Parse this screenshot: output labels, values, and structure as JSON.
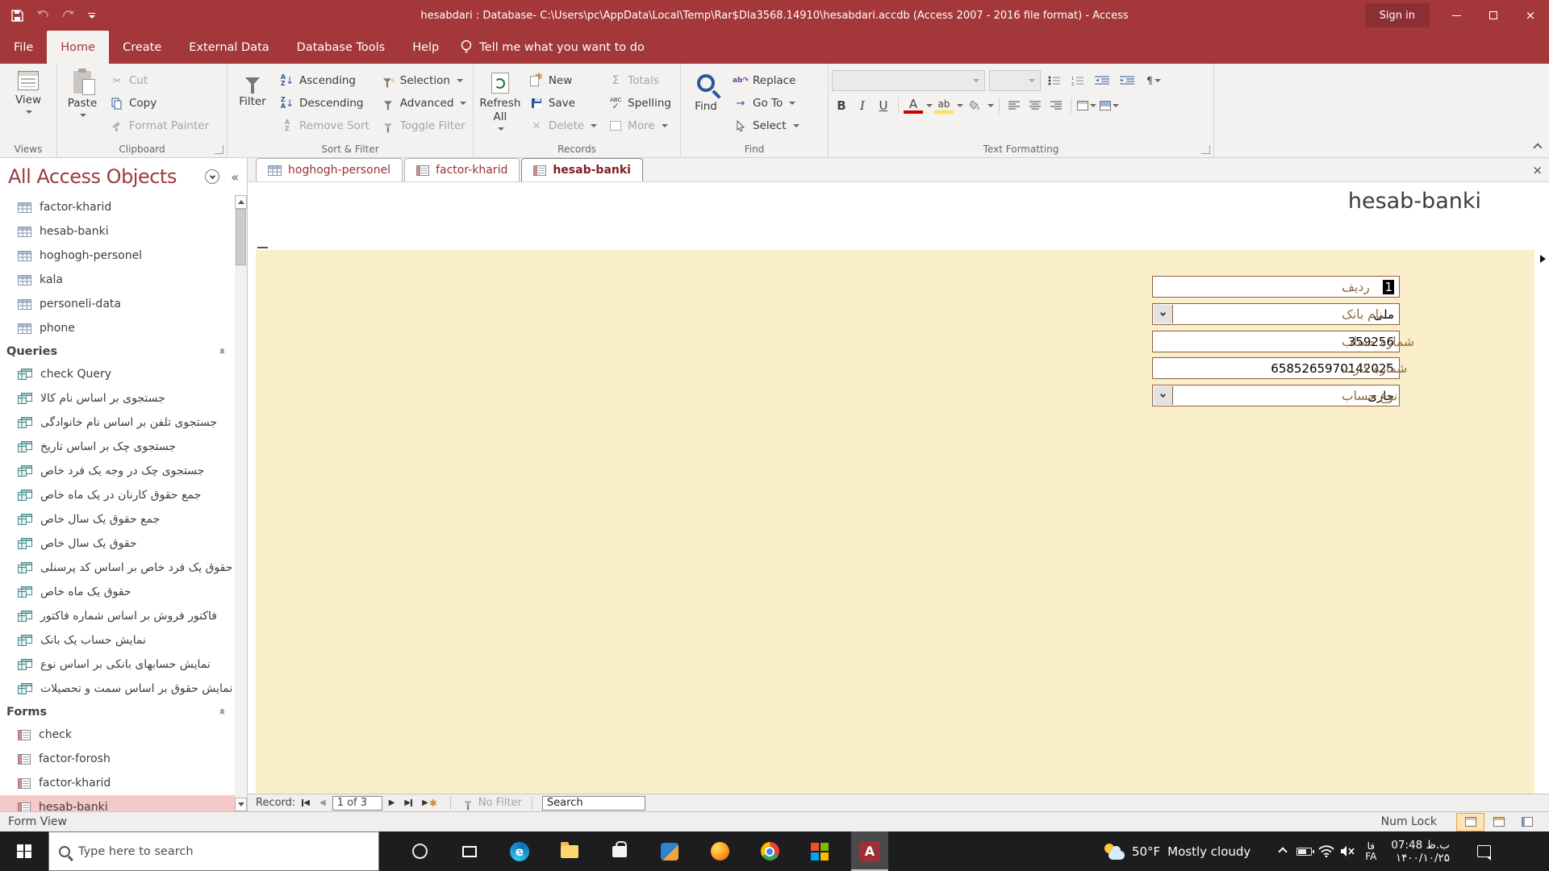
{
  "colors": {
    "accent": "#a4373a",
    "form_bg": "#fbeecb",
    "selection_pink": "#f5c8c9"
  },
  "titlebar": {
    "title": "hesabdari : Database- C:\\Users\\pc\\AppData\\Local\\Temp\\Rar$Dla3568.14910\\hesabdari.accdb (Access 2007 - 2016 file format) - Access",
    "sign_in": "Sign in"
  },
  "menu": {
    "tabs": [
      "File",
      "Home",
      "Create",
      "External Data",
      "Database Tools",
      "Help"
    ],
    "tell_me": "Tell me what you want to do"
  },
  "ribbon": {
    "views": {
      "label": "Views",
      "view": "View"
    },
    "clipboard": {
      "label": "Clipboard",
      "paste": "Paste",
      "cut": "Cut",
      "copy": "Copy",
      "format_painter": "Format Painter"
    },
    "sort": {
      "label": "Sort & Filter",
      "filter": "Filter",
      "ascending": "Ascending",
      "descending": "Descending",
      "remove_sort": "Remove Sort",
      "selection": "Selection",
      "advanced": "Advanced",
      "toggle_filter": "Toggle Filter"
    },
    "records": {
      "label": "Records",
      "refresh_all": "Refresh All",
      "new": "New",
      "save": "Save",
      "delete": "Delete",
      "totals": "Totals",
      "spelling": "Spelling",
      "more": "More"
    },
    "find": {
      "label": "Find",
      "find": "Find",
      "replace": "Replace",
      "go_to": "Go To",
      "select": "Select"
    },
    "text": {
      "label": "Text Formatting"
    }
  },
  "nav": {
    "title": "All Access Objects",
    "tables": [
      "factor-kharid",
      "hesab-banki",
      "hoghogh-personel",
      "kala",
      "personeli-data",
      "phone"
    ],
    "queries_header": "Queries",
    "queries": [
      "check Query",
      "جستجوی بر اساس نام کالا",
      "جستجوی تلفن بر اساس نام خانوادگی",
      "جستجوی چک بر اساس تاریخ",
      "جستجوی چک در وجه یک فرد خاص",
      "جمع حقوق کارنان در یک ماه خاص",
      "جمع حقوق یک سال خاص",
      "حقوق یک سال خاص",
      "حقوق یک فرد خاص بر اساس کد پرسنلی",
      "حقوق یک ماه خاص",
      "فاکتور فروش بر اساس شماره فاکتور",
      "نمایش حساب یک بانک",
      "نمایش حسابهای بانکی بر اساس نوع",
      "نمایش حقوق بر اساس سمت و تحصیلات"
    ],
    "forms_header": "Forms",
    "forms": [
      "check",
      "factor-forosh",
      "factor-kharid",
      "hesab-banki"
    ]
  },
  "doc_tabs": [
    {
      "label": "hoghogh-personel"
    },
    {
      "label": "factor-kharid"
    },
    {
      "label": "hesab-banki"
    }
  ],
  "form": {
    "title": "hesab-banki",
    "fields": [
      {
        "label": "ردیف",
        "value": "1"
      },
      {
        "label": "نام بانک",
        "value": "ملی"
      },
      {
        "label": "شماره حساب",
        "value": "359256"
      },
      {
        "label": "شماره کارت",
        "value": "6585265970142025"
      },
      {
        "label": "نوع حساب",
        "value": "جاری"
      }
    ]
  },
  "recordbar": {
    "label": "Record:",
    "position": "1 of 3",
    "no_filter": "No Filter",
    "search": "Search"
  },
  "statusbar": {
    "view": "Form View",
    "num_lock": "Num Lock"
  },
  "taskbar": {
    "search_placeholder": "Type here to search",
    "weather": {
      "temp": "50°F",
      "desc": "Mostly cloudy"
    },
    "lang": {
      "native": "فا",
      "latin": "FA"
    },
    "clock": {
      "time": "ب.ظ 07:48",
      "date": "۱۴۰۰/۱۰/۲۵"
    }
  }
}
